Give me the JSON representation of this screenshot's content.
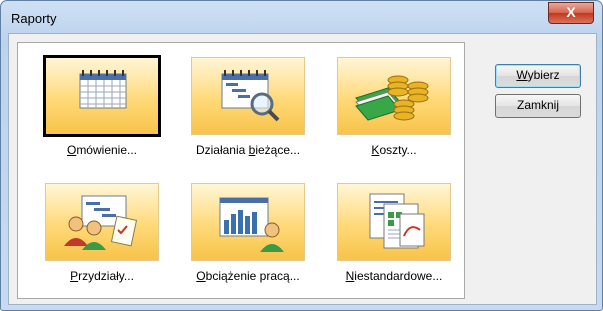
{
  "window": {
    "title": "Raporty",
    "close_label": "X"
  },
  "tiles": [
    {
      "pre": "",
      "accel": "O",
      "post": "mówienie...",
      "icon": "calendar-grid-icon",
      "selected": true
    },
    {
      "pre": "Działania ",
      "accel": "b",
      "post": "ieżące...",
      "icon": "gantt-magnifier-icon",
      "selected": false
    },
    {
      "pre": "",
      "accel": "K",
      "post": "oszty...",
      "icon": "money-coins-icon",
      "selected": false
    },
    {
      "pre": "",
      "accel": "P",
      "post": "rzydziały...",
      "icon": "people-assignment-icon",
      "selected": false
    },
    {
      "pre": "",
      "accel": "O",
      "post": "bciążenie pracą...",
      "icon": "workload-chart-icon",
      "selected": false
    },
    {
      "pre": "",
      "accel": "N",
      "post": "iestandardowe...",
      "icon": "custom-documents-icon",
      "selected": false
    }
  ],
  "buttons": {
    "select": {
      "accel": "W",
      "post": "ybierz"
    },
    "close": {
      "text": "Zamknij"
    }
  }
}
